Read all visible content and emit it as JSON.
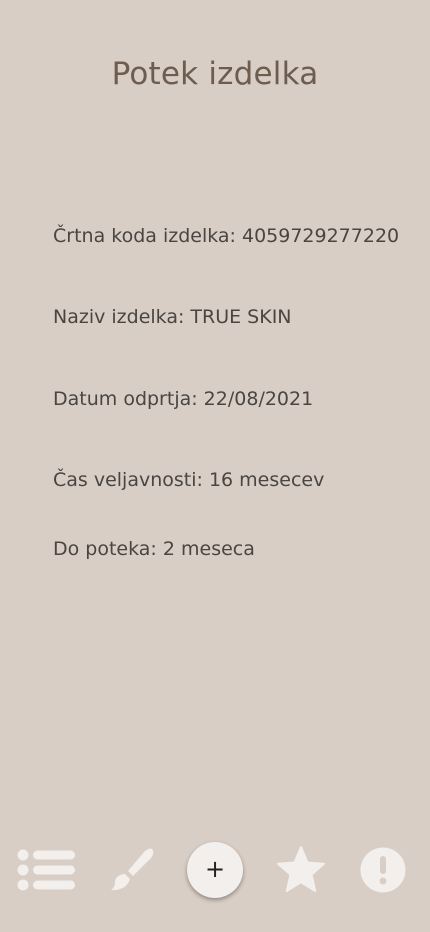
{
  "header": {
    "title": "Potek izdelka"
  },
  "product": {
    "barcode": "Črtna koda izdelka: 4059729277220",
    "name": "Naziv izdelka: TRUE SKIN",
    "opened_date": "Datum odprtja: 22/08/2021",
    "shelf_life": "Čas veljavnosti: 16 mesecev",
    "expires_in": "Do poteka: 2 meseca"
  },
  "bottom_nav": {
    "items": [
      {
        "icon": "list-icon"
      },
      {
        "icon": "paintbrush-icon"
      },
      {
        "icon": "plus-icon",
        "label": "+"
      },
      {
        "icon": "star-icon"
      },
      {
        "icon": "exclamation-icon"
      }
    ]
  },
  "colors": {
    "background": "#d8cec5",
    "title": "#6e5d4f",
    "text": "#4a4542",
    "icon": "#f2efec",
    "fab_background": "#f2efec"
  }
}
